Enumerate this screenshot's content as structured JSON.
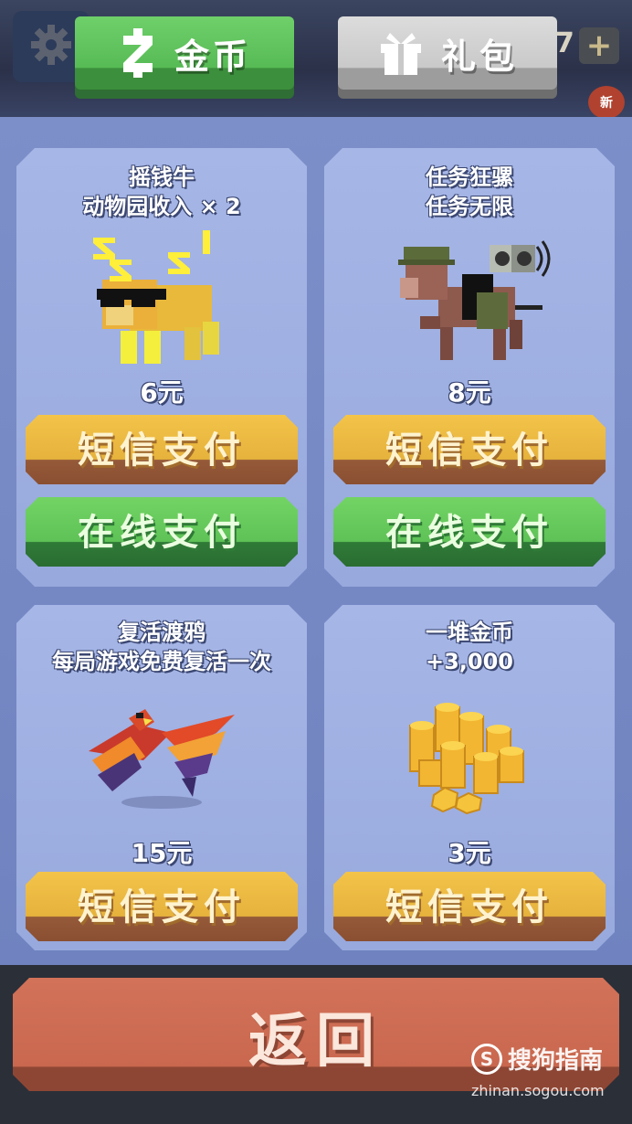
{
  "header": {
    "tab_coins_label": "金币",
    "tab_gift_label": "礼包",
    "count_value": "7",
    "new_badge": "新"
  },
  "items": [
    {
      "title_line1": "摇钱牛",
      "title_line2": "动物园收入 × 2",
      "price": "6元",
      "sms_label": "短信支付",
      "online_label": "在线支付",
      "icon": "money-cow"
    },
    {
      "title_line1": "任务狂骡",
      "title_line2": "任务无限",
      "price": "8元",
      "sms_label": "短信支付",
      "online_label": "在线支付",
      "icon": "mission-mule"
    },
    {
      "title_line1": "复活渡鸦",
      "title_line2": "每局游戏免费复活一次",
      "price": "15元",
      "sms_label": "短信支付",
      "icon": "revive-raven"
    },
    {
      "title_line1": "一堆金币",
      "title_line2": "+3,000",
      "price": "3元",
      "sms_label": "短信支付",
      "icon": "coin-pile"
    }
  ],
  "footer": {
    "back_label": "返回"
  },
  "watermark": {
    "logo_text": "S",
    "brand": "搜狗指南",
    "url": "zhinan.sogou.com"
  },
  "colors": {
    "panel": "#7d8fc9",
    "card": "#a6b6e6",
    "sms_button": "#f3c449",
    "online_button": "#5ec257",
    "back_button": "#d27259"
  }
}
